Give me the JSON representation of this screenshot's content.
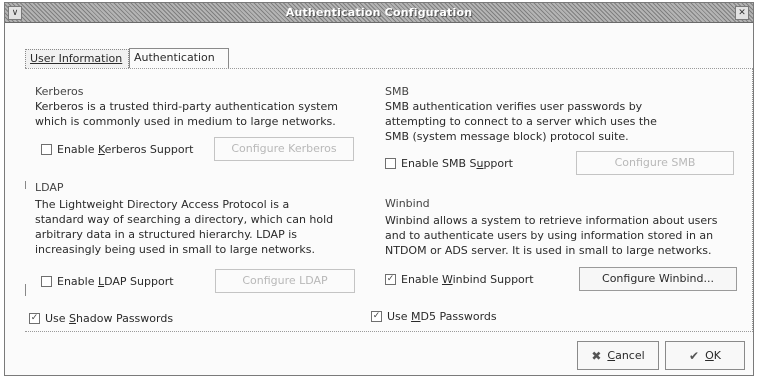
{
  "window": {
    "title": "Authentication Configuration",
    "menu_glyph": "∨",
    "close_glyph": "✕"
  },
  "tabs": [
    {
      "label": "User Information"
    },
    {
      "label": "Authentication"
    }
  ],
  "kerberos": {
    "title": "Kerberos",
    "desc_lines": [
      "Kerberos is a trusted third-party authentication system",
      "which is commonly used in medium to large networks."
    ],
    "enable_pre": "Enable ",
    "enable_accel": "K",
    "enable_post": "erberos Support",
    "checked": false,
    "configure_label": "Configure Kerberos"
  },
  "smb": {
    "title": "SMB",
    "desc_lines": [
      "SMB authentication verifies user passwords by",
      "attempting to connect to a server which uses the",
      "SMB (system message block) protocol suite."
    ],
    "enable_pre": "Enable SMB S",
    "enable_accel": "u",
    "enable_post": "pport",
    "checked": false,
    "configure_label": "Configure SMB"
  },
  "ldap": {
    "title": "LDAP",
    "desc_lines": [
      "The Lightweight Directory Access Protocol is a",
      "standard way of searching a directory, which can hold",
      "arbitrary data in a structured hierarchy.  LDAP is",
      "increasingly being used in small to large networks."
    ],
    "enable_pre": "Enable ",
    "enable_accel": "L",
    "enable_post": "DAP Support",
    "checked": false,
    "configure_label": "Configure LDAP"
  },
  "winbind": {
    "title": "Winbind",
    "desc_lines": [
      "Winbind allows a system to retrieve information about users",
      "and to authenticate users by using information stored in an",
      "NTDOM or ADS server.  It is used in small to large networks."
    ],
    "enable_pre": "Enable ",
    "enable_accel": "W",
    "enable_post": "inbind Support",
    "checked": true,
    "configure_label": "Configure Winbind..."
  },
  "shadow": {
    "pre": "Use ",
    "accel": "S",
    "post": "hadow Passwords",
    "checked": true
  },
  "md5": {
    "pre": "Use ",
    "accel": "M",
    "post": "D5 Passwords",
    "checked": true
  },
  "check_mark": "✓",
  "footer": {
    "cancel_icon": "✖",
    "cancel_accel": "C",
    "cancel_rest": "ancel",
    "ok_icon": "✔",
    "ok_accel": "O",
    "ok_rest": "K"
  }
}
